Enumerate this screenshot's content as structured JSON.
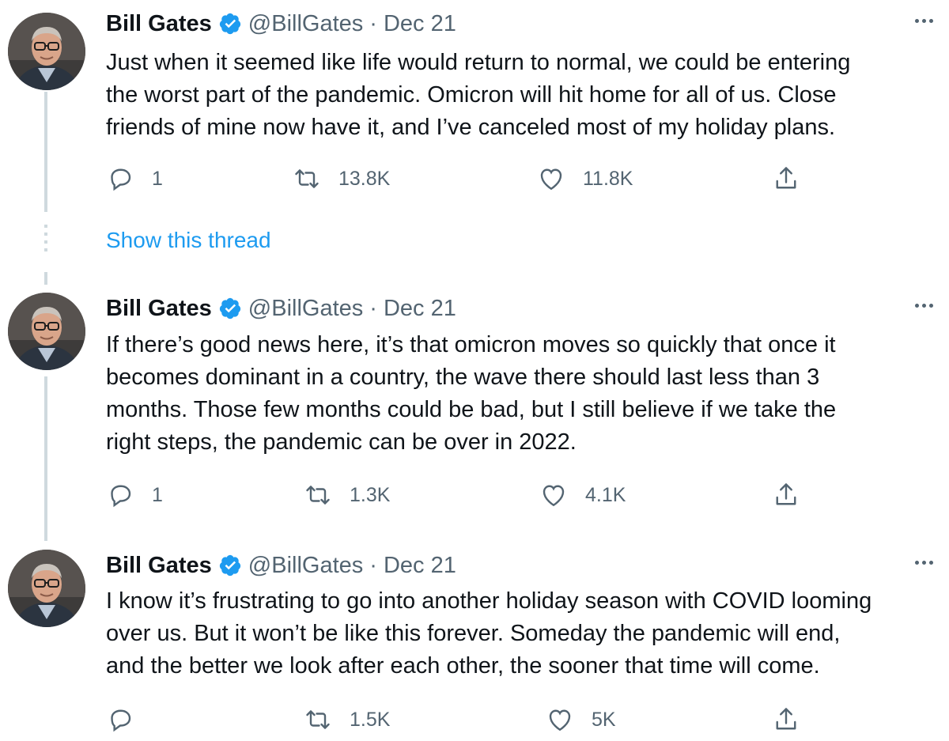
{
  "accent_color": "#1d9bf0",
  "muted_color": "#536471",
  "show_thread_label": "Show this thread",
  "tweets": [
    {
      "author": "Bill Gates",
      "handle": "@BillGates",
      "separator": "·",
      "date": "Dec 21",
      "verified": true,
      "lines": [
        "Just when it seemed like life would return to normal, we could be entering",
        "the worst part of the pandemic. Omicron will hit home for all of us. Close",
        "friends of mine now have it, and I’ve canceled most of my holiday plans."
      ],
      "replies": "1",
      "retweets": "13.8K",
      "likes": "11.8K"
    },
    {
      "author": "Bill Gates",
      "handle": "@BillGates",
      "separator": "·",
      "date": "Dec 21",
      "verified": true,
      "lines": [
        "If there’s good news here, it’s that omicron moves so quickly that once it",
        "becomes dominant in a country, the wave there should last less than 3",
        "months. Those few months could be bad, but I still believe if we take the",
        "right steps, the pandemic can be over in 2022."
      ],
      "replies": "1",
      "retweets": "1.3K",
      "likes": "4.1K"
    },
    {
      "author": "Bill Gates",
      "handle": "@BillGates",
      "separator": "·",
      "date": "Dec 21",
      "verified": true,
      "lines": [
        "I know it’s frustrating to go into another holiday season with COVID looming",
        "over us. But it won’t be like this forever. Someday the pandemic will end,",
        "and the better we look after each other, the sooner that time will come."
      ],
      "replies": "",
      "retweets": "1.5K",
      "likes": "5K"
    }
  ]
}
